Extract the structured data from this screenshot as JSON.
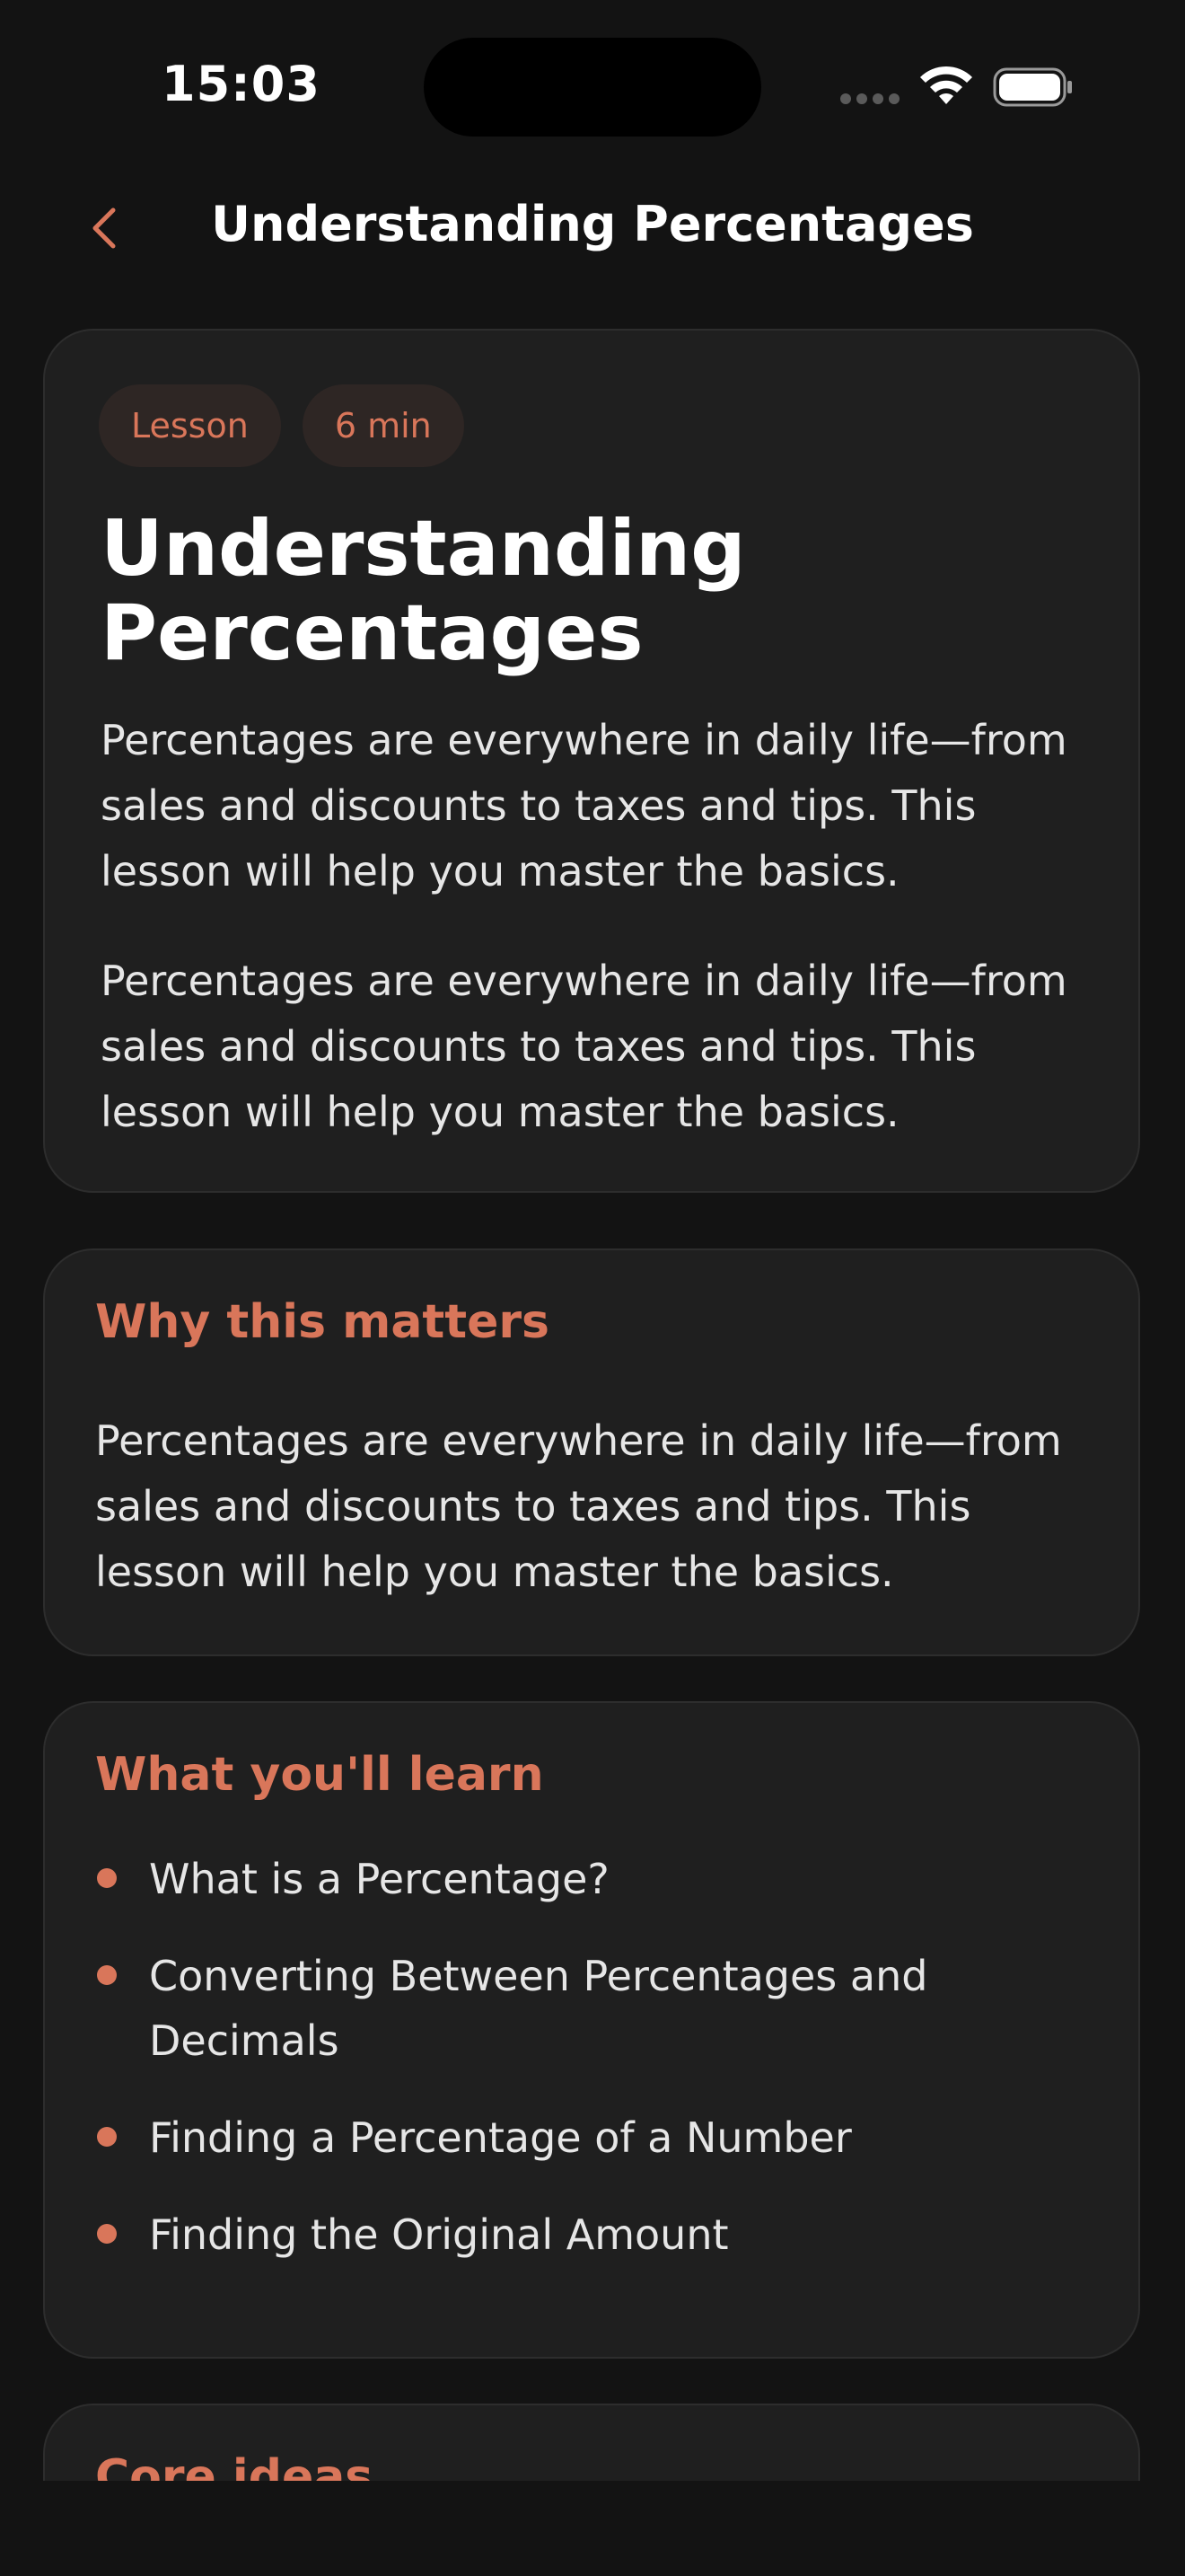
{
  "status_bar": {
    "time": "15:03"
  },
  "nav": {
    "title": "Understanding Percentages",
    "back_icon": "chevron-left-icon"
  },
  "hero": {
    "badges": [
      "Lesson",
      "6 min"
    ],
    "title": "Understanding Percentages",
    "paragraphs": [
      "Percentages are everywhere in daily life—from sales and discounts to taxes and tips. This lesson will help you master the basics.",
      "Percentages are everywhere in daily life—from sales and discounts to taxes and tips. This lesson will help you master the basics."
    ]
  },
  "why": {
    "title": "Why this matters",
    "text": "Percentages are everywhere in daily life—from sales and discounts to taxes and tips. This lesson will help you master the basics."
  },
  "learn": {
    "title": "What you'll learn",
    "items": [
      "What is a Percentage?",
      "Converting Between Percentages and Decimals",
      "Finding a Percentage of a Number",
      "Finding the Original Amount"
    ]
  },
  "core": {
    "title": "Core ideas"
  },
  "colors": {
    "accent": "#d9765a",
    "background": "#131313",
    "card": "#1f1f1f"
  }
}
